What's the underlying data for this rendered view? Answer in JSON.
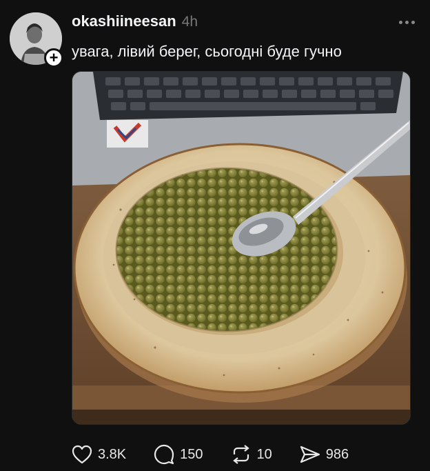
{
  "post": {
    "username": "okashiineesan",
    "time": "4h",
    "text": "увага, лівий берег, сьогодні буде гучно",
    "follow_symbol": "+",
    "image_alt": "Bowl of canned green peas with a spoon in front of a laptop keyboard"
  },
  "actions": {
    "likes": "3.8K",
    "replies": "150",
    "reposts": "10",
    "shares": "986"
  },
  "icons": [
    "heart-icon",
    "comment-icon",
    "repost-icon",
    "share-icon",
    "more-icon",
    "plus-icon"
  ],
  "colors": {
    "background": "#101010",
    "text": "#f3f5f7",
    "muted": "#777777"
  }
}
